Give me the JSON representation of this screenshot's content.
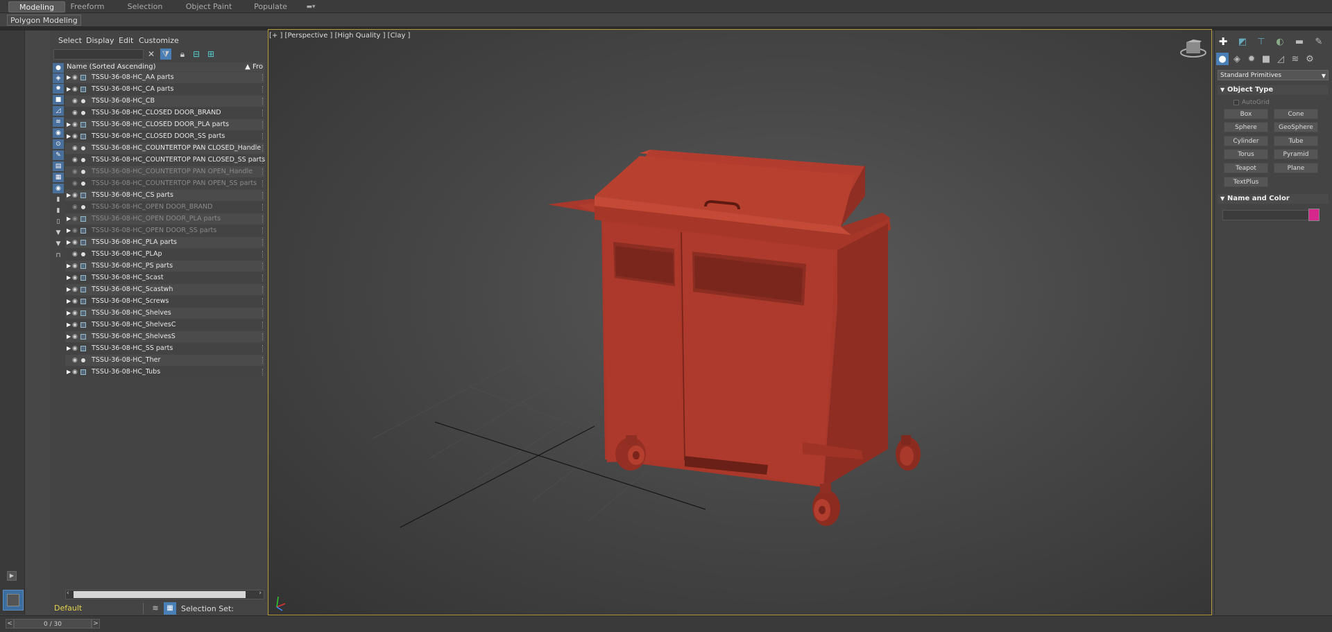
{
  "ribbon": {
    "tabs": [
      "Modeling",
      "Freeform",
      "Selection",
      "Object Paint",
      "Populate"
    ],
    "active_tab": "Modeling",
    "sub_tab": "Polygon Modeling"
  },
  "explorer": {
    "menus": [
      "Select",
      "Display",
      "Edit",
      "Customize"
    ],
    "column_header": "Name (Sorted Ascending)",
    "column_header_right": "▲ Fro",
    "rows": [
      {
        "name": "TSSU-36-08-HC_AA parts",
        "group": true,
        "hidden": false
      },
      {
        "name": "TSSU-36-08-HC_CA parts",
        "group": true,
        "hidden": false
      },
      {
        "name": "TSSU-36-08-HC_CB",
        "group": false,
        "hidden": false
      },
      {
        "name": "TSSU-36-08-HC_CLOSED DOOR_BRAND",
        "group": false,
        "hidden": false
      },
      {
        "name": "TSSU-36-08-HC_CLOSED DOOR_PLA parts",
        "group": true,
        "hidden": false
      },
      {
        "name": "TSSU-36-08-HC_CLOSED DOOR_SS parts",
        "group": true,
        "hidden": false
      },
      {
        "name": "TSSU-36-08-HC_COUNTERTOP PAN CLOSED_Handle",
        "group": false,
        "hidden": false
      },
      {
        "name": "TSSU-36-08-HC_COUNTERTOP PAN CLOSED_SS parts",
        "group": false,
        "hidden": false
      },
      {
        "name": "TSSU-36-08-HC_COUNTERTOP PAN OPEN_Handle",
        "group": false,
        "hidden": true
      },
      {
        "name": "TSSU-36-08-HC_COUNTERTOP PAN OPEN_SS parts",
        "group": false,
        "hidden": true
      },
      {
        "name": "TSSU-36-08-HC_CS parts",
        "group": true,
        "hidden": false
      },
      {
        "name": "TSSU-36-08-HC_OPEN DOOR_BRAND",
        "group": false,
        "hidden": true
      },
      {
        "name": "TSSU-36-08-HC_OPEN DOOR_PLA parts",
        "group": true,
        "hidden": true
      },
      {
        "name": "TSSU-36-08-HC_OPEN DOOR_SS parts",
        "group": true,
        "hidden": true
      },
      {
        "name": "TSSU-36-08-HC_PLA parts",
        "group": true,
        "hidden": false
      },
      {
        "name": "TSSU-36-08-HC_PLAp",
        "group": false,
        "hidden": false
      },
      {
        "name": "TSSU-36-08-HC_PS parts",
        "group": true,
        "hidden": false
      },
      {
        "name": "TSSU-36-08-HC_Scast",
        "group": true,
        "hidden": false
      },
      {
        "name": "TSSU-36-08-HC_Scastwh",
        "group": true,
        "hidden": false
      },
      {
        "name": "TSSU-36-08-HC_Screws",
        "group": true,
        "hidden": false
      },
      {
        "name": "TSSU-36-08-HC_Shelves",
        "group": true,
        "hidden": false
      },
      {
        "name": "TSSU-36-08-HC_ShelvesC",
        "group": true,
        "hidden": false
      },
      {
        "name": "TSSU-36-08-HC_ShelvesS",
        "group": true,
        "hidden": false
      },
      {
        "name": "TSSU-36-08-HC_SS parts",
        "group": true,
        "hidden": false
      },
      {
        "name": "TSSU-36-08-HC_Ther",
        "group": false,
        "hidden": false
      },
      {
        "name": "TSSU-36-08-HC_Tubs",
        "group": true,
        "hidden": false
      }
    ],
    "layer": "Default",
    "selection_set_label": "Selection Set:"
  },
  "viewport": {
    "label": "[+ ] [Perspective ] [High Quality ] [Clay ]",
    "model_color": "#b23c2e"
  },
  "command_panel": {
    "dropdown": "Standard Primitives",
    "object_type_title": "Object Type",
    "autogrid": "AutoGrid",
    "buttons": [
      "Box",
      "Cone",
      "Sphere",
      "GeoSphere",
      "Cylinder",
      "Tube",
      "Torus",
      "Pyramid",
      "Teapot",
      "Plane",
      "TextPlus"
    ],
    "name_color_title": "Name and Color",
    "color_swatch": "#d6288c"
  },
  "status": {
    "time_slider": "0 / 30"
  }
}
